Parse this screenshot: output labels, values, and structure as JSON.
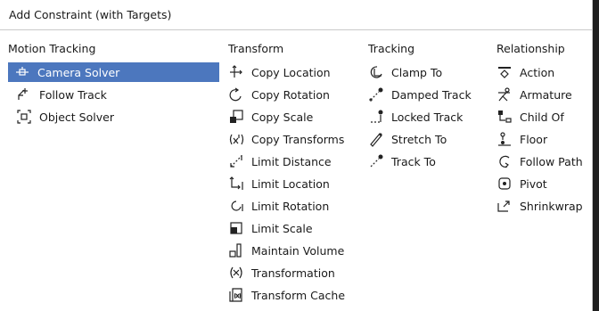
{
  "menu": {
    "title": "Add Constraint (with Targets)",
    "columns": [
      {
        "heading": "Motion Tracking",
        "items": [
          {
            "label": "Camera Solver",
            "icon": "camera-solver-icon",
            "selected": true
          },
          {
            "label": "Follow Track",
            "icon": "follow-track-icon"
          },
          {
            "label": "Object Solver",
            "icon": "object-solver-icon"
          }
        ]
      },
      {
        "heading": "Transform",
        "items": [
          {
            "label": "Copy Location",
            "icon": "copy-location-icon"
          },
          {
            "label": "Copy Rotation",
            "icon": "copy-rotation-icon"
          },
          {
            "label": "Copy Scale",
            "icon": "copy-scale-icon"
          },
          {
            "label": "Copy Transforms",
            "icon": "copy-transforms-icon"
          },
          {
            "label": "Limit Distance",
            "icon": "limit-distance-icon"
          },
          {
            "label": "Limit Location",
            "icon": "limit-location-icon"
          },
          {
            "label": "Limit Rotation",
            "icon": "limit-rotation-icon"
          },
          {
            "label": "Limit Scale",
            "icon": "limit-scale-icon"
          },
          {
            "label": "Maintain Volume",
            "icon": "maintain-volume-icon"
          },
          {
            "label": "Transformation",
            "icon": "transformation-icon"
          },
          {
            "label": "Transform Cache",
            "icon": "transform-cache-icon"
          }
        ]
      },
      {
        "heading": "Tracking",
        "items": [
          {
            "label": "Clamp To",
            "icon": "clamp-to-icon"
          },
          {
            "label": "Damped Track",
            "icon": "damped-track-icon"
          },
          {
            "label": "Locked Track",
            "icon": "locked-track-icon"
          },
          {
            "label": "Stretch To",
            "icon": "stretch-to-icon"
          },
          {
            "label": "Track To",
            "icon": "track-to-icon"
          }
        ]
      },
      {
        "heading": "Relationship",
        "items": [
          {
            "label": "Action",
            "icon": "action-icon"
          },
          {
            "label": "Armature",
            "icon": "armature-icon"
          },
          {
            "label": "Child Of",
            "icon": "child-of-icon"
          },
          {
            "label": "Floor",
            "icon": "floor-icon"
          },
          {
            "label": "Follow Path",
            "icon": "follow-path-icon"
          },
          {
            "label": "Pivot",
            "icon": "pivot-icon"
          },
          {
            "label": "Shrinkwrap",
            "icon": "shrinkwrap-icon"
          }
        ]
      }
    ]
  },
  "colors": {
    "selection": "#4c77be",
    "background": "#ffffff",
    "outside": "#1f1f1f"
  }
}
